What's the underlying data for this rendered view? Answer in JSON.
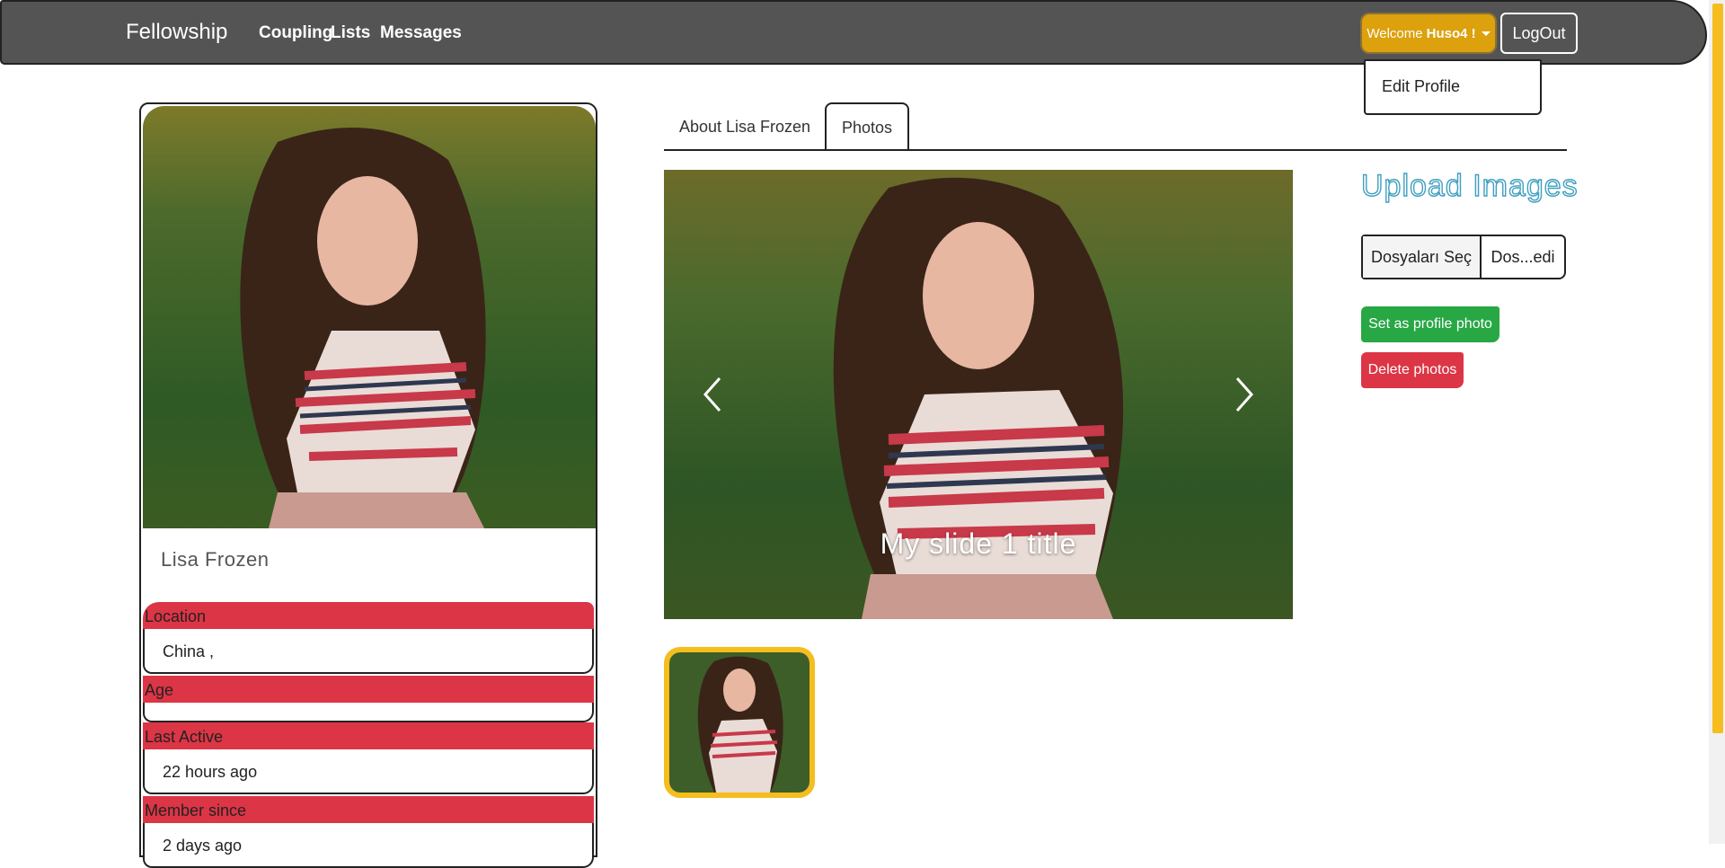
{
  "navbar": {
    "brand": "Fellowship",
    "links": [
      "Coupling",
      "Lists",
      "Messages"
    ],
    "welcome_prefix": "Welcome",
    "welcome_user": "Huso4 !",
    "logout": "LogOut",
    "dropdown": {
      "edit_profile": "Edit Profile"
    }
  },
  "profile": {
    "name": "Lisa Frozen",
    "fields": [
      {
        "label": "Location",
        "value": "China ,"
      },
      {
        "label": "Age",
        "value": ""
      },
      {
        "label": "Last Active",
        "value": "22 hours ago"
      },
      {
        "label": "Member since",
        "value": "2 days ago"
      }
    ]
  },
  "tabs": {
    "about": "About Lisa Frozen",
    "photos": "Photos"
  },
  "carousel": {
    "slide_title": "My slide 1 title"
  },
  "upload": {
    "title": "Upload Images",
    "choose_files": "Dosyaları Seç",
    "file_name": "Dos...edi",
    "set_profile": "Set as profile photo",
    "delete": "Delete photos"
  },
  "colors": {
    "navbar": "#545454",
    "welcome": "#dca10c",
    "label_red": "#dc3545",
    "green": "#28a745",
    "upload_title": "#40a0c0",
    "thumb_border": "#f5bd1d"
  }
}
